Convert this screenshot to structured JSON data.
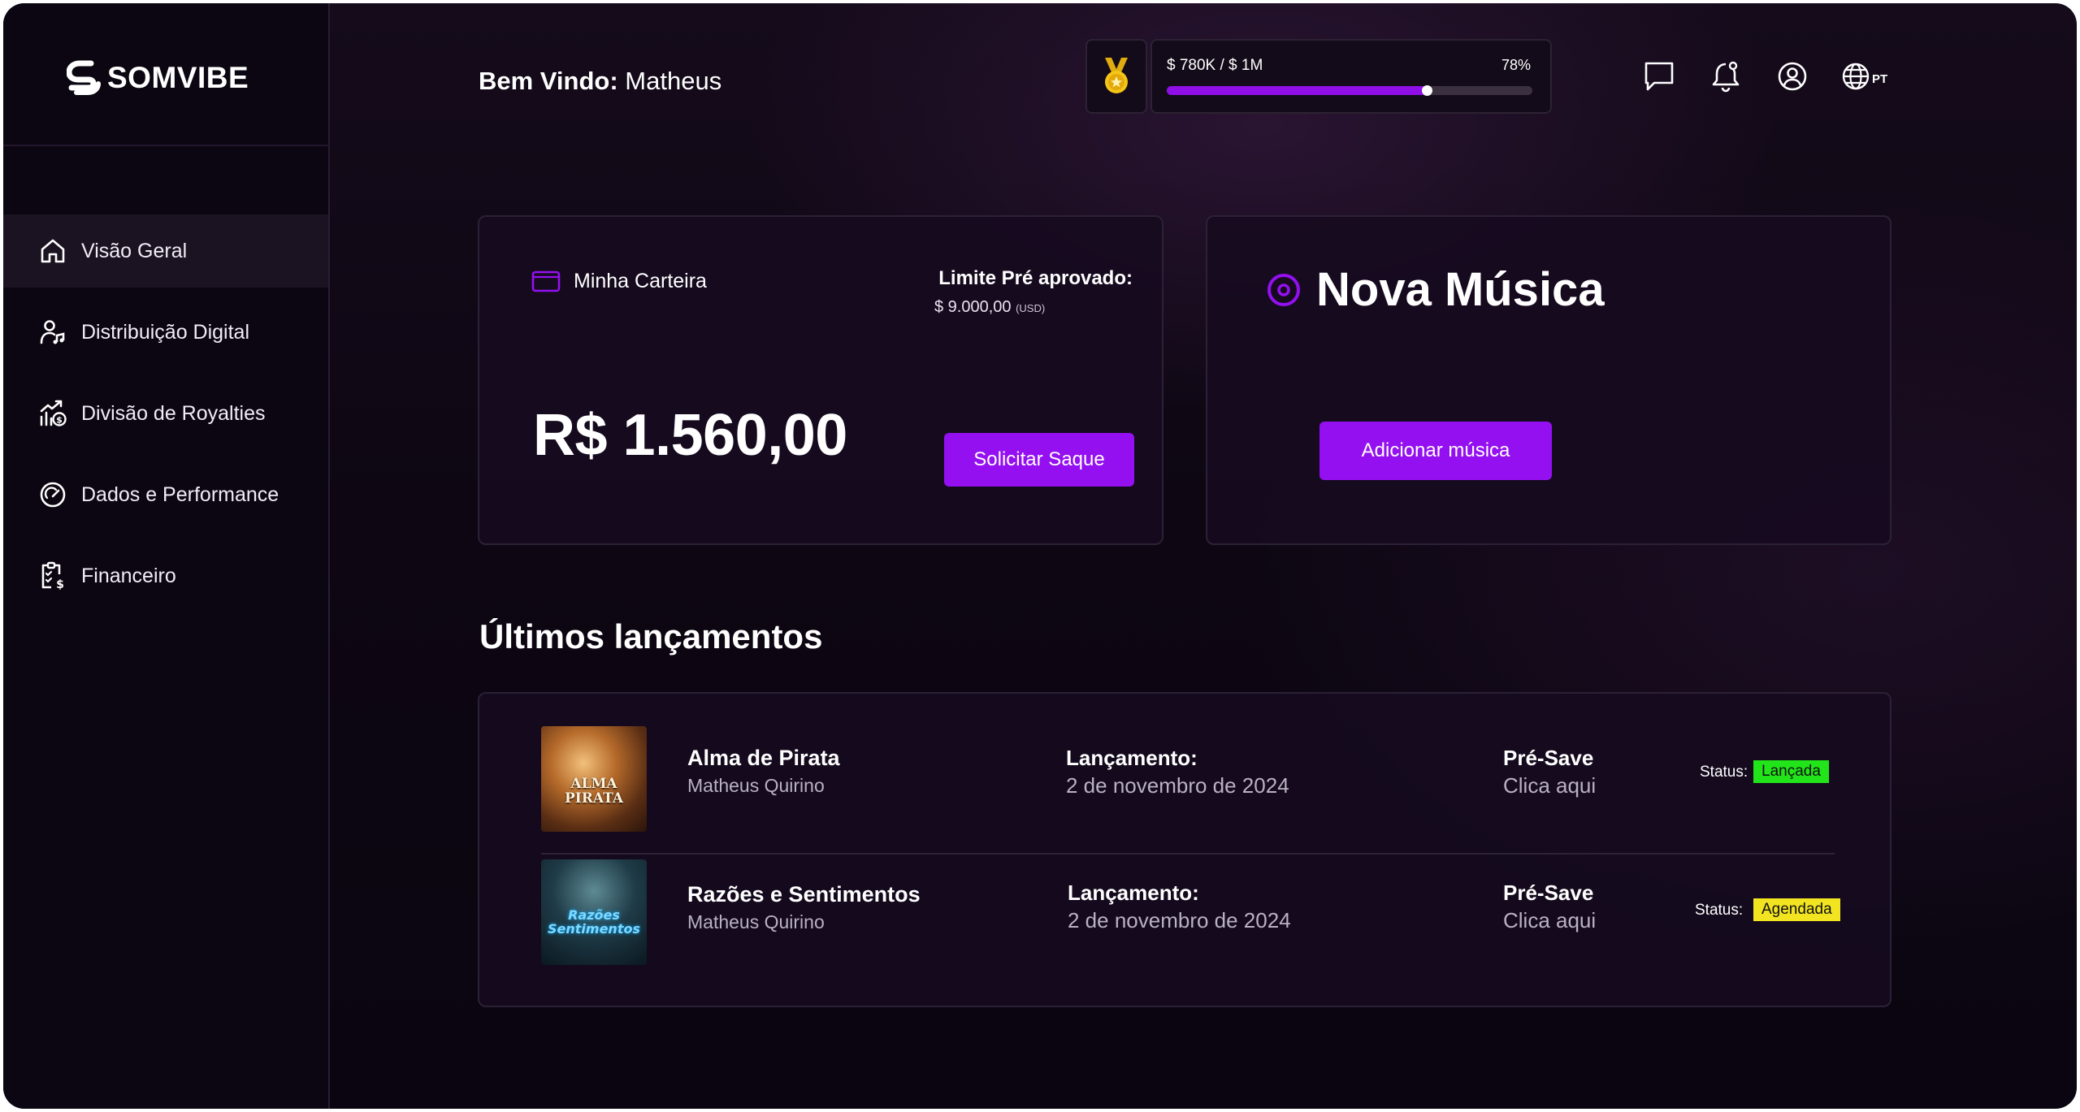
{
  "brand": {
    "name": "SOMVIBE"
  },
  "sidebar": {
    "items": [
      {
        "label": "Visão Geral",
        "icon": "home-icon",
        "active": true
      },
      {
        "label": "Distribuição Digital",
        "icon": "user-music-icon",
        "active": false
      },
      {
        "label": "Divisão de Royalties",
        "icon": "chart-dollar-icon",
        "active": false
      },
      {
        "label": "Dados e Performance",
        "icon": "gauge-icon",
        "active": false
      },
      {
        "label": "Financeiro",
        "icon": "clipboard-dollar-icon",
        "active": false
      }
    ]
  },
  "header": {
    "welcome_prefix": "Bem Vindo:",
    "user_name": "Matheus",
    "goal": {
      "label": "$ 780K / $ 1M",
      "percent_label": "78%",
      "progress": 0.71,
      "icon": "medal-icon"
    },
    "icons": [
      "chat-icon",
      "bell-icon",
      "user-circle-icon",
      "globe-icon"
    ],
    "language": "PT"
  },
  "wallet": {
    "title": "Minha Carteira",
    "icon": "wallet-icon",
    "limit_title": "Limite Pré aprovado:",
    "limit_value": "$ 9.000,00",
    "limit_unit": "(USD)",
    "balance": "R$ 1.560,00",
    "withdraw_button": "Solicitar Saque"
  },
  "new_music": {
    "title": "Nova Música",
    "icon": "disc-icon",
    "add_button": "Adicionar música"
  },
  "releases": {
    "title": "Últimos lançamentos",
    "items": [
      {
        "name": "Alma de Pirata",
        "artist": "Matheus Quirino",
        "release_label": "Lançamento:",
        "release_date": "2 de novembro de 2024",
        "presave_label": "Pré-Save",
        "presave_link": "Clica aqui",
        "status_label": "Status:",
        "status": "Lançada",
        "status_color": "#22e41a",
        "cover_text": "ALMA PIRATA"
      },
      {
        "name": "Razões e Sentimentos",
        "artist": "Matheus Quirino",
        "release_label": "Lançamento:",
        "release_date": "2 de novembro de 2024",
        "presave_label": "Pré-Save",
        "presave_link": "Clica aqui",
        "status_label": "Status:",
        "status": "Agendada",
        "status_color": "#f2e420",
        "cover_text": "Razões Sentimentos"
      }
    ]
  },
  "colors": {
    "accent": "#9410f0",
    "background": "#0e0713",
    "gold": "#f5c518"
  }
}
